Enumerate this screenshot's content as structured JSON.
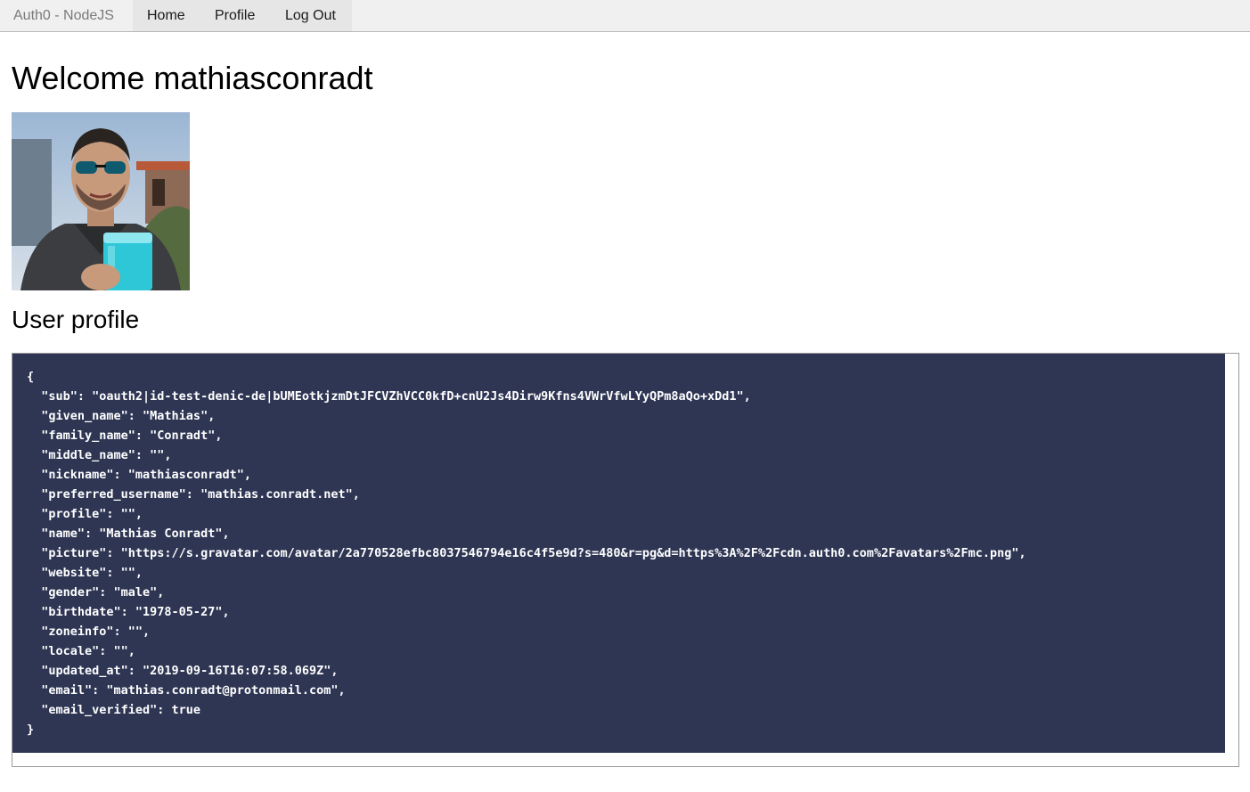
{
  "nav": {
    "brand": "Auth0 - NodeJS",
    "links": [
      "Home",
      "Profile",
      "Log Out"
    ]
  },
  "welcome": "Welcome mathiasconradt",
  "section_title": "User profile",
  "profile_json_lines": [
    "{",
    "  \"sub\": \"oauth2|id-test-denic-de|bUMEotkjzmDtJFCVZhVCC0kfD+cnU2Js4Dirw9Kfns4VWrVfwLYyQPm8aQo+xDd1\",",
    "  \"given_name\": \"Mathias\",",
    "  \"family_name\": \"Conradt\",",
    "  \"middle_name\": \"\",",
    "  \"nickname\": \"mathiasconradt\",",
    "  \"preferred_username\": \"mathias.conradt.net\",",
    "  \"profile\": \"\",",
    "  \"name\": \"Mathias Conradt\",",
    "  \"picture\": \"https://s.gravatar.com/avatar/2a770528efbc8037546794e16c4f5e9d?s=480&r=pg&d=https%3A%2F%2Fcdn.auth0.com%2Favatars%2Fmc.png\",",
    "  \"website\": \"\",",
    "  \"gender\": \"male\",",
    "  \"birthdate\": \"1978-05-27\",",
    "  \"zoneinfo\": \"\",",
    "  \"locale\": \"\",",
    "  \"updated_at\": \"2019-09-16T16:07:58.069Z\",",
    "  \"email\": \"mathias.conradt@protonmail.com\",",
    "  \"email_verified\": true",
    "}"
  ],
  "colors": {
    "code_background": "#2e3654",
    "navbar_background": "#f0f0f0"
  }
}
